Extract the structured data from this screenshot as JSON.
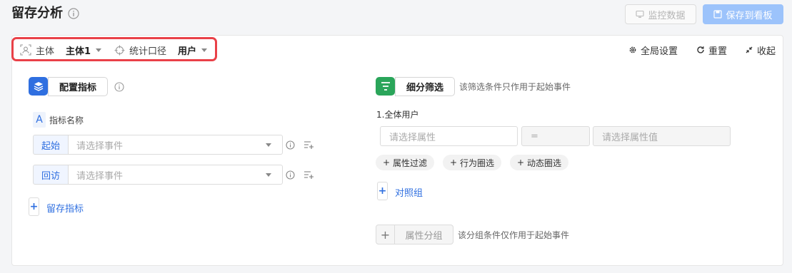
{
  "header": {
    "title": "留存分析",
    "monitor_label": "监控数据",
    "save_label": "保存到看板"
  },
  "toolbar": {
    "subject_label": "主体",
    "subject_value": "主体1",
    "stat_label": "统计口径",
    "stat_value": "用户",
    "global_settings_label": "全局设置",
    "reset_label": "重置",
    "collapse_label": "收起"
  },
  "metrics": {
    "config_label": "配置指标",
    "name_letter": "A",
    "name_label": "指标名称",
    "rows": [
      {
        "tag": "起始",
        "placeholder": "请选择事件"
      },
      {
        "tag": "回访",
        "placeholder": "请选择事件"
      }
    ],
    "add_label": "留存指标"
  },
  "filter": {
    "section_label": "细分筛选",
    "hint": "该筛选条件只作用于起始事件",
    "group_title": "1.全体用户",
    "attr_placeholder": "请选择属性",
    "operator": "=",
    "value_placeholder": "请选择属性值",
    "chips": [
      "属性过滤",
      "行为圈选",
      "动态圈选"
    ],
    "compare_label": "对照组",
    "group_button_label": "属性分组",
    "group_hint": "该分组条件仅作用于起始事件"
  },
  "colors": {
    "brand_blue": "#2f6fe0",
    "highlight_red": "#e94148",
    "filter_green": "#2aa55a"
  }
}
